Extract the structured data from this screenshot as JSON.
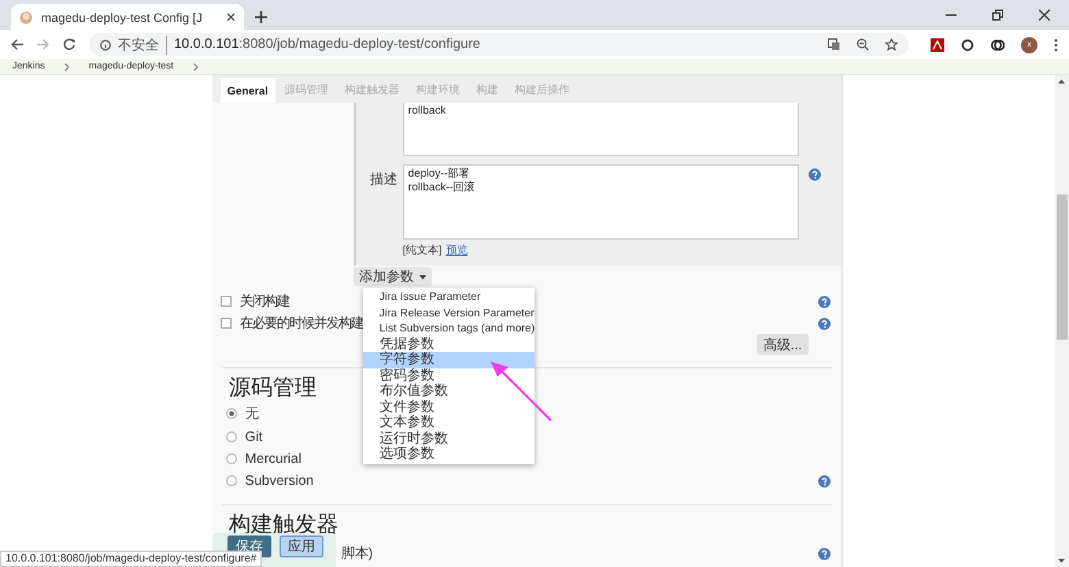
{
  "browser": {
    "tab_title": "magedu-deploy-test Config [J",
    "security": "不安全",
    "url": "10.0.0.101:8080/job/magedu-deploy-test/configure",
    "avatar": "x"
  },
  "breadcrumbs": [
    "Jenkins",
    "magedu-deploy-test"
  ],
  "tabs": [
    {
      "label": "General",
      "selected": true
    },
    {
      "label": "源码管理",
      "selected": false
    },
    {
      "label": "构建触发器",
      "selected": false
    },
    {
      "label": "构建环境",
      "selected": false
    },
    {
      "label": "构建",
      "selected": false
    },
    {
      "label": "构建后操作",
      "selected": false
    }
  ],
  "parameter": {
    "choices_value": "rollback",
    "description_label": "描述",
    "description_value": "deploy--部署\nrollback--回滚",
    "format_note": "[纯文本]",
    "preview_link": "预览"
  },
  "add_parameter_button": "添加参数",
  "parameter_menu": [
    {
      "label": "Jira Issue Parameter",
      "selected": false
    },
    {
      "label": "Jira Release Version Parameter",
      "selected": false
    },
    {
      "label": "List Subversion tags (and more)",
      "selected": false
    },
    {
      "label": "凭据参数",
      "selected": false
    },
    {
      "label": "字符参数",
      "selected": true
    },
    {
      "label": "密码参数",
      "selected": false
    },
    {
      "label": "布尔值参数",
      "selected": false
    },
    {
      "label": "文件参数",
      "selected": false
    },
    {
      "label": "文本参数",
      "selected": false
    },
    {
      "label": "运行时参数",
      "selected": false
    },
    {
      "label": "选项参数",
      "selected": false
    }
  ],
  "options": [
    {
      "label": "关闭构建",
      "checked": false
    },
    {
      "label": "在必要的时候并发构建",
      "checked": false
    }
  ],
  "advanced_button": "高级...",
  "scm_section": {
    "title": "源码管理",
    "choices": [
      {
        "label": "无",
        "selected": true
      },
      {
        "label": "Git",
        "selected": false
      },
      {
        "label": "Mercurial",
        "selected": false
      },
      {
        "label": "Subversion",
        "selected": false
      }
    ]
  },
  "triggers_section": {
    "title": "构建触发器",
    "partial_text": "脚本)"
  },
  "action_buttons": [
    "保存",
    "应用"
  ],
  "status_bar": "10.0.0.101:8080/job/magedu-deploy-test/configure#"
}
